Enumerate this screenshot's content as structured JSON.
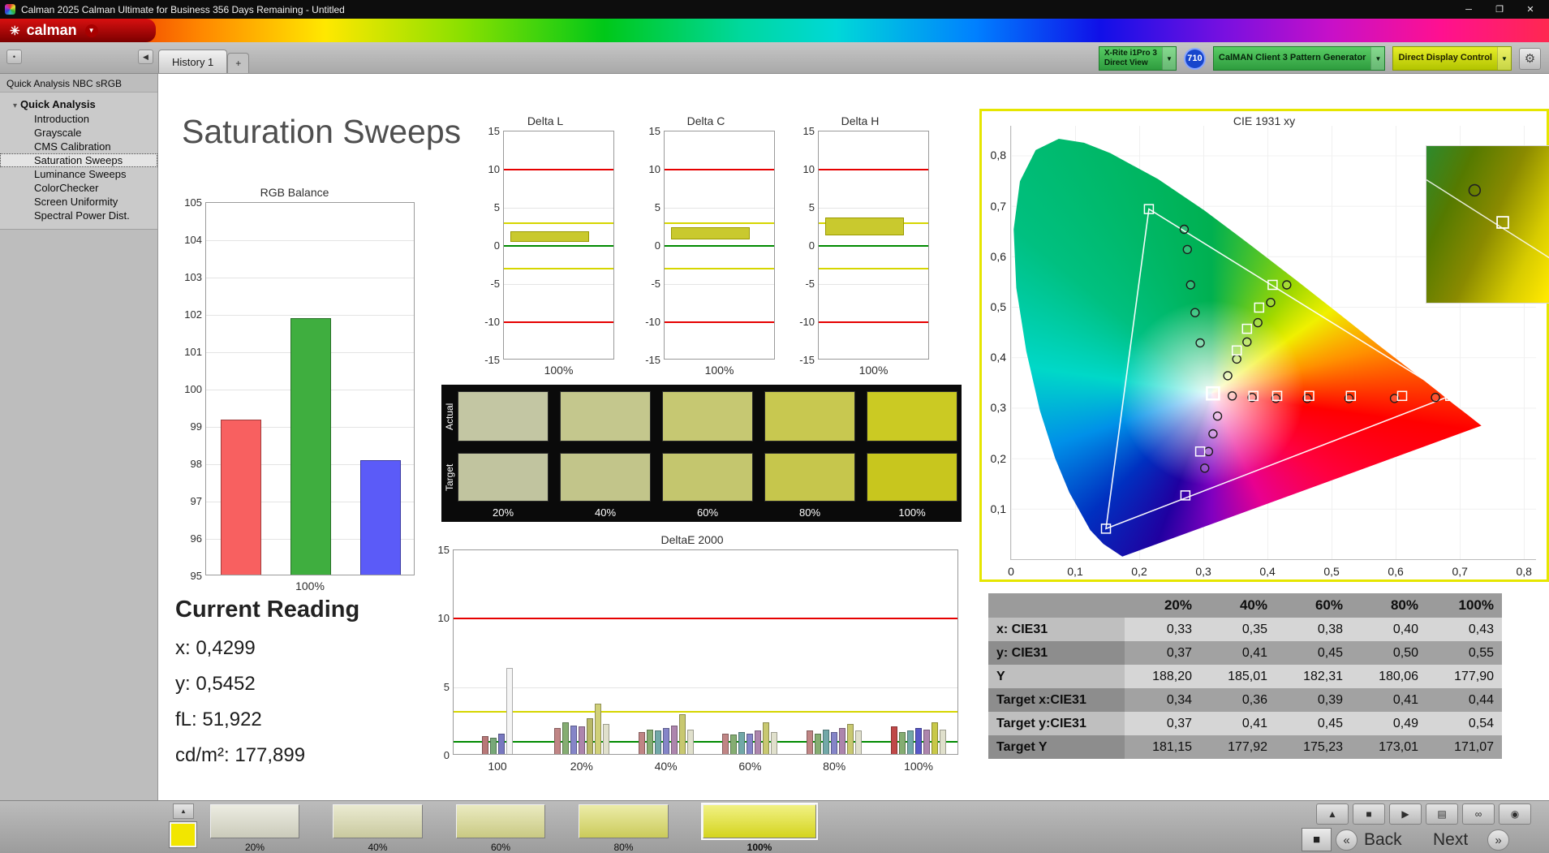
{
  "titlebar": {
    "title": "Calman 2025 Calman Ultimate for Business 356 Days Remaining  - Untitled",
    "minimize": "─",
    "maximize": "❐",
    "close": "✕"
  },
  "logo": {
    "brand": "calman",
    "flower": "✳",
    "dropdown": "▼"
  },
  "tabs": {
    "history": "History 1",
    "add": "+",
    "dot": "•",
    "collapse": "◀"
  },
  "devices": {
    "meter_line1": "X-Rite i1Pro 3",
    "meter_line2": "Direct View",
    "badge": "710",
    "generator": "CalMAN Client 3 Pattern Generator",
    "display": "Direct Display Control",
    "dropdown": "▼",
    "gear": "⚙"
  },
  "sidebar": {
    "header": "Quick Analysis NBC sRGB",
    "expander": "▾",
    "root": "Quick Analysis",
    "items": [
      "Introduction",
      "Grayscale",
      "CMS Calibration",
      "Saturation Sweeps",
      "Luminance Sweeps",
      "ColorChecker",
      "Screen Uniformity",
      "Spectral Power Dist."
    ],
    "selected": "Saturation Sweeps"
  },
  "page": {
    "title": "Saturation Sweeps"
  },
  "current_reading": {
    "title": "Current Reading",
    "lines": [
      "x: 0,4299",
      "y: 0,5452",
      "fL: 51,922",
      "cd/m²: 177,899"
    ]
  },
  "swatch_grid": {
    "row_labels": [
      "Actual",
      "Target"
    ],
    "col_labels": [
      "20%",
      "40%",
      "60%",
      "80%",
      "100%"
    ],
    "actual_colors": [
      "#c3c6a3",
      "#c4c78d",
      "#c6c872",
      "#c8c850",
      "#cbca23"
    ],
    "target_colors": [
      "#c1c49f",
      "#c2c58a",
      "#c4c66e",
      "#c6c64c",
      "#c8c61e"
    ]
  },
  "chart_data": [
    {
      "type": "bar",
      "title": "RGB Balance",
      "xlabel": "100%",
      "categories": [
        "Red",
        "Green",
        "Blue"
      ],
      "values": [
        99.15,
        101.88,
        98.07
      ],
      "colors": [
        "#f86060",
        "#3fae3f",
        "#5b5bf8"
      ],
      "ylim": [
        95,
        105
      ],
      "yticks": [
        95,
        96,
        97,
        98,
        99,
        100,
        101,
        102,
        103,
        104,
        105
      ]
    },
    {
      "type": "bar",
      "title": "Delta L",
      "xlabel": "100%",
      "ylim": [
        -15,
        15
      ],
      "yticks": [
        -15,
        -10,
        -5,
        0,
        5,
        10,
        15
      ],
      "limit_lines": {
        "red": [
          10,
          -10
        ],
        "yellow": [
          3,
          -3
        ],
        "green": [
          0
        ]
      },
      "bar": {
        "from": 0.5,
        "to": 1.9,
        "color": "#c9c92e"
      }
    },
    {
      "type": "bar",
      "title": "Delta C",
      "xlabel": "100%",
      "ylim": [
        -15,
        15
      ],
      "yticks": [
        -15,
        -10,
        -5,
        0,
        5,
        10,
        15
      ],
      "limit_lines": {
        "red": [
          10,
          -10
        ],
        "yellow": [
          3,
          -3
        ],
        "green": [
          0
        ]
      },
      "bar": {
        "from": 0.8,
        "to": 2.4,
        "color": "#c9c92e"
      }
    },
    {
      "type": "bar",
      "title": "Delta H",
      "xlabel": "100%",
      "ylim": [
        -15,
        15
      ],
      "yticks": [
        -15,
        -10,
        -5,
        0,
        5,
        10,
        15
      ],
      "limit_lines": {
        "red": [
          10,
          -10
        ],
        "yellow": [
          3,
          -3
        ],
        "green": [
          0
        ]
      },
      "bar": {
        "from": 1.4,
        "to": 3.7,
        "color": "#c9c92e"
      }
    },
    {
      "type": "grouped-bar",
      "title": "DeltaE 2000",
      "ylim": [
        0,
        15
      ],
      "yticks": [
        0,
        5,
        10,
        15
      ],
      "limit_lines": {
        "red": 10,
        "yellow": 3.2,
        "green": 1
      },
      "groups": [
        {
          "label": "100",
          "bars": [
            {
              "c": "#b87878",
              "v": 1.3
            },
            {
              "c": "#78a878",
              "v": 1.2
            },
            {
              "c": "#7878c0",
              "v": 1.5
            },
            {
              "c": "#f5f5f5",
              "v": 6.3
            }
          ]
        },
        {
          "label": "20%",
          "bars": [
            {
              "c": "#c08585",
              "v": 1.9
            },
            {
              "c": "#85ad72",
              "v": 2.3
            },
            {
              "c": "#8585c8",
              "v": 2.1
            },
            {
              "c": "#ad85ad",
              "v": 2.0
            },
            {
              "c": "#b8b868",
              "v": 2.6
            },
            {
              "c": "#d0d078",
              "v": 3.7
            },
            {
              "c": "#e0e0cc",
              "v": 2.2
            }
          ]
        },
        {
          "label": "40%",
          "bars": [
            {
              "c": "#c08585",
              "v": 1.6
            },
            {
              "c": "#85ad72",
              "v": 1.8
            },
            {
              "c": "#72a8a8",
              "v": 1.7
            },
            {
              "c": "#8585c8",
              "v": 1.9
            },
            {
              "c": "#ad85ad",
              "v": 2.1
            },
            {
              "c": "#c8c870",
              "v": 2.9
            },
            {
              "c": "#e0e0cc",
              "v": 1.8
            }
          ]
        },
        {
          "label": "60%",
          "bars": [
            {
              "c": "#c08585",
              "v": 1.5
            },
            {
              "c": "#85ad72",
              "v": 1.4
            },
            {
              "c": "#72a8a8",
              "v": 1.6
            },
            {
              "c": "#8585c8",
              "v": 1.5
            },
            {
              "c": "#ad85ad",
              "v": 1.7
            },
            {
              "c": "#c8c870",
              "v": 2.3
            },
            {
              "c": "#e0e0cc",
              "v": 1.6
            }
          ]
        },
        {
          "label": "80%",
          "bars": [
            {
              "c": "#c08585",
              "v": 1.7
            },
            {
              "c": "#85ad72",
              "v": 1.5
            },
            {
              "c": "#72a8a8",
              "v": 1.8
            },
            {
              "c": "#8585c8",
              "v": 1.6
            },
            {
              "c": "#ad85ad",
              "v": 1.9
            },
            {
              "c": "#c8c870",
              "v": 2.2
            },
            {
              "c": "#e0e0cc",
              "v": 1.7
            }
          ]
        },
        {
          "label": "100%",
          "bars": [
            {
              "c": "#c04848",
              "v": 2.0
            },
            {
              "c": "#85ad72",
              "v": 1.6
            },
            {
              "c": "#72a8a8",
              "v": 1.7
            },
            {
              "c": "#5858c8",
              "v": 1.9
            },
            {
              "c": "#ad85ad",
              "v": 1.8
            },
            {
              "c": "#c8c848",
              "v": 2.3
            },
            {
              "c": "#e0e0cc",
              "v": 1.8
            }
          ]
        }
      ]
    },
    {
      "type": "scatter",
      "title": "CIE 1931 xy",
      "xlim": [
        0,
        0.82
      ],
      "ylim": [
        0,
        0.86
      ],
      "xticks": [
        "0",
        "0,1",
        "0,2",
        "0,3",
        "0,4",
        "0,5",
        "0,6",
        "0,7",
        "0,8"
      ],
      "yticks": [
        "0,1",
        "0,2",
        "0,3",
        "0,4",
        "0,5",
        "0,6",
        "0,7",
        "0,8"
      ],
      "gamut_triangle": [
        [
          0.215,
          0.695
        ],
        [
          0.685,
          0.325
        ],
        [
          0.148,
          0.062
        ]
      ],
      "current_target": [
        0.315,
        0.33
      ],
      "targets": [
        [
          0.685,
          0.325
        ],
        [
          0.61,
          0.325
        ],
        [
          0.53,
          0.325
        ],
        [
          0.465,
          0.325
        ],
        [
          0.415,
          0.325
        ],
        [
          0.378,
          0.325
        ],
        [
          0.44,
          0.585
        ],
        [
          0.408,
          0.545
        ],
        [
          0.387,
          0.5
        ],
        [
          0.368,
          0.458
        ],
        [
          0.352,
          0.415
        ],
        [
          0.295,
          0.215
        ],
        [
          0.272,
          0.128
        ],
        [
          0.148,
          0.062
        ],
        [
          0.215,
          0.695
        ]
      ],
      "measurements": [
        [
          0.662,
          0.322
        ],
        [
          0.598,
          0.32
        ],
        [
          0.527,
          0.32
        ],
        [
          0.462,
          0.32
        ],
        [
          0.413,
          0.32
        ],
        [
          0.376,
          0.322
        ],
        [
          0.345,
          0.325
        ],
        [
          0.43,
          0.545
        ],
        [
          0.405,
          0.51
        ],
        [
          0.385,
          0.47
        ],
        [
          0.368,
          0.432
        ],
        [
          0.352,
          0.398
        ],
        [
          0.338,
          0.365
        ],
        [
          0.322,
          0.285
        ],
        [
          0.315,
          0.25
        ],
        [
          0.308,
          0.215
        ],
        [
          0.302,
          0.182
        ],
        [
          0.275,
          0.615
        ],
        [
          0.28,
          0.545
        ],
        [
          0.287,
          0.49
        ],
        [
          0.295,
          0.43
        ],
        [
          0.27,
          0.655
        ]
      ]
    }
  ],
  "table": {
    "columns": [
      "20%",
      "40%",
      "60%",
      "80%",
      "100%"
    ],
    "rows": [
      {
        "label": "x: CIE31",
        "values": [
          "0,33",
          "0,35",
          "0,38",
          "0,40",
          "0,43"
        ]
      },
      {
        "label": "y: CIE31",
        "values": [
          "0,37",
          "0,41",
          "0,45",
          "0,50",
          "0,55"
        ]
      },
      {
        "label": "Y",
        "values": [
          "188,20",
          "185,01",
          "182,31",
          "180,06",
          "177,90"
        ]
      },
      {
        "label": "Target x:CIE31",
        "values": [
          "0,34",
          "0,36",
          "0,39",
          "0,41",
          "0,44"
        ]
      },
      {
        "label": "Target y:CIE31",
        "values": [
          "0,37",
          "0,41",
          "0,45",
          "0,49",
          "0,54"
        ]
      },
      {
        "label": "Target Y",
        "values": [
          "181,15",
          "177,92",
          "175,23",
          "173,01",
          "171,07"
        ]
      }
    ]
  },
  "bottom": {
    "swatches": [
      {
        "label": "20%",
        "color": "#dcdcca",
        "selected": false
      },
      {
        "label": "40%",
        "color": "#dadaac",
        "selected": false
      },
      {
        "label": "60%",
        "color": "#dada8e",
        "selected": false
      },
      {
        "label": "80%",
        "color": "#dcdc62",
        "selected": false
      },
      {
        "label": "100%",
        "color": "#e6e620",
        "selected": true
      }
    ],
    "mini_up": "▲",
    "mini_color": "#f2e600",
    "transport": [
      "▲",
      "■",
      "▶",
      "▤",
      "∞",
      "◉"
    ],
    "pattern_button": "■",
    "prev_icon": "«",
    "next_icon": "»",
    "back_label": "Back",
    "next_label": "Next"
  }
}
